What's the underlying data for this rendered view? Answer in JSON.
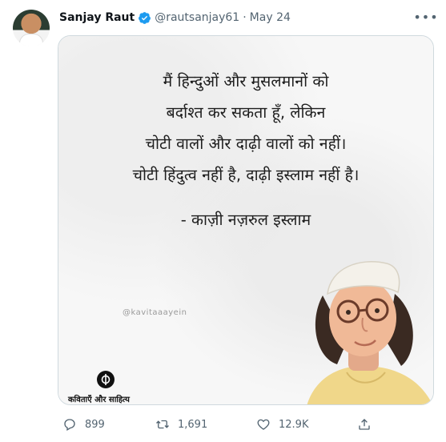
{
  "tweet": {
    "author_name": "Sanjay Raut",
    "handle": "@rautsanjay61",
    "separator": "·",
    "date": "May 24",
    "more_label": "•••"
  },
  "media": {
    "quote_lines": [
      "मैं हिन्दुओं और मुसलमानों को",
      "बर्दाश्त कर सकता हूँ, लेकिन",
      "चोटी वालों और दाढ़ी वालों को नहीं।",
      "चोटी हिंदुत्व नहीं है, दाढ़ी इस्लाम नहीं है।"
    ],
    "attribution": "- काज़ी नज़रुल इस्लाम",
    "watermark": "@kavitaaayein",
    "brand_name": "कविताएँ और साहित्य"
  },
  "actions": {
    "replies": "899",
    "retweets": "1,691",
    "likes": "12.9K"
  },
  "colors": {
    "verified": "#1d9bf0",
    "secondary_text": "#536471",
    "border": "#cfd9de"
  }
}
